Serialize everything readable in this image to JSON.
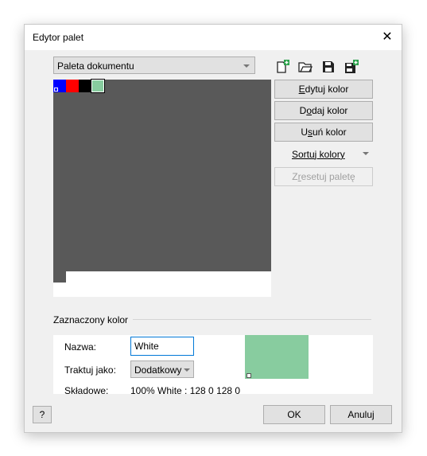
{
  "dialog": {
    "title": "Edytor palet",
    "close_glyph": "✕"
  },
  "palette": {
    "selected": "Paleta dokumentu"
  },
  "toolbar": {
    "icons": [
      "new-palette-icon",
      "open-palette-icon",
      "save-palette-icon",
      "save-as-palette-icon"
    ]
  },
  "swatches": [
    {
      "name": "blue",
      "color": "#0000ff"
    },
    {
      "name": "red",
      "color": "#ff0000"
    },
    {
      "name": "black",
      "color": "#000000"
    },
    {
      "name": "green-selected",
      "color": "#88cc9f"
    }
  ],
  "buttons": {
    "edit_color": {
      "pre": "",
      "key": "E",
      "post": "dytuj kolor"
    },
    "add_color": {
      "pre": "D",
      "key": "o",
      "post": "daj kolor"
    },
    "remove_color": {
      "pre": "U",
      "key": "s",
      "post": "uń kolor"
    },
    "sort_colors": "Sortuj kolory",
    "reset_palette": {
      "pre": "Z",
      "key": "r",
      "post": "esetuj paletę"
    }
  },
  "selected_color": {
    "group_label": "Zaznaczony kolor",
    "name_label": "Nazwa:",
    "name_value": "White",
    "treat_as_label": "Traktuj jako:",
    "treat_as_value": "Dodatkowy",
    "components_label": "Składowe:",
    "components_value": "100% White : 128 0 128 0",
    "preview_color": "#88cc9f"
  },
  "footer": {
    "help": "?",
    "ok": "OK",
    "cancel": "Anuluj"
  }
}
